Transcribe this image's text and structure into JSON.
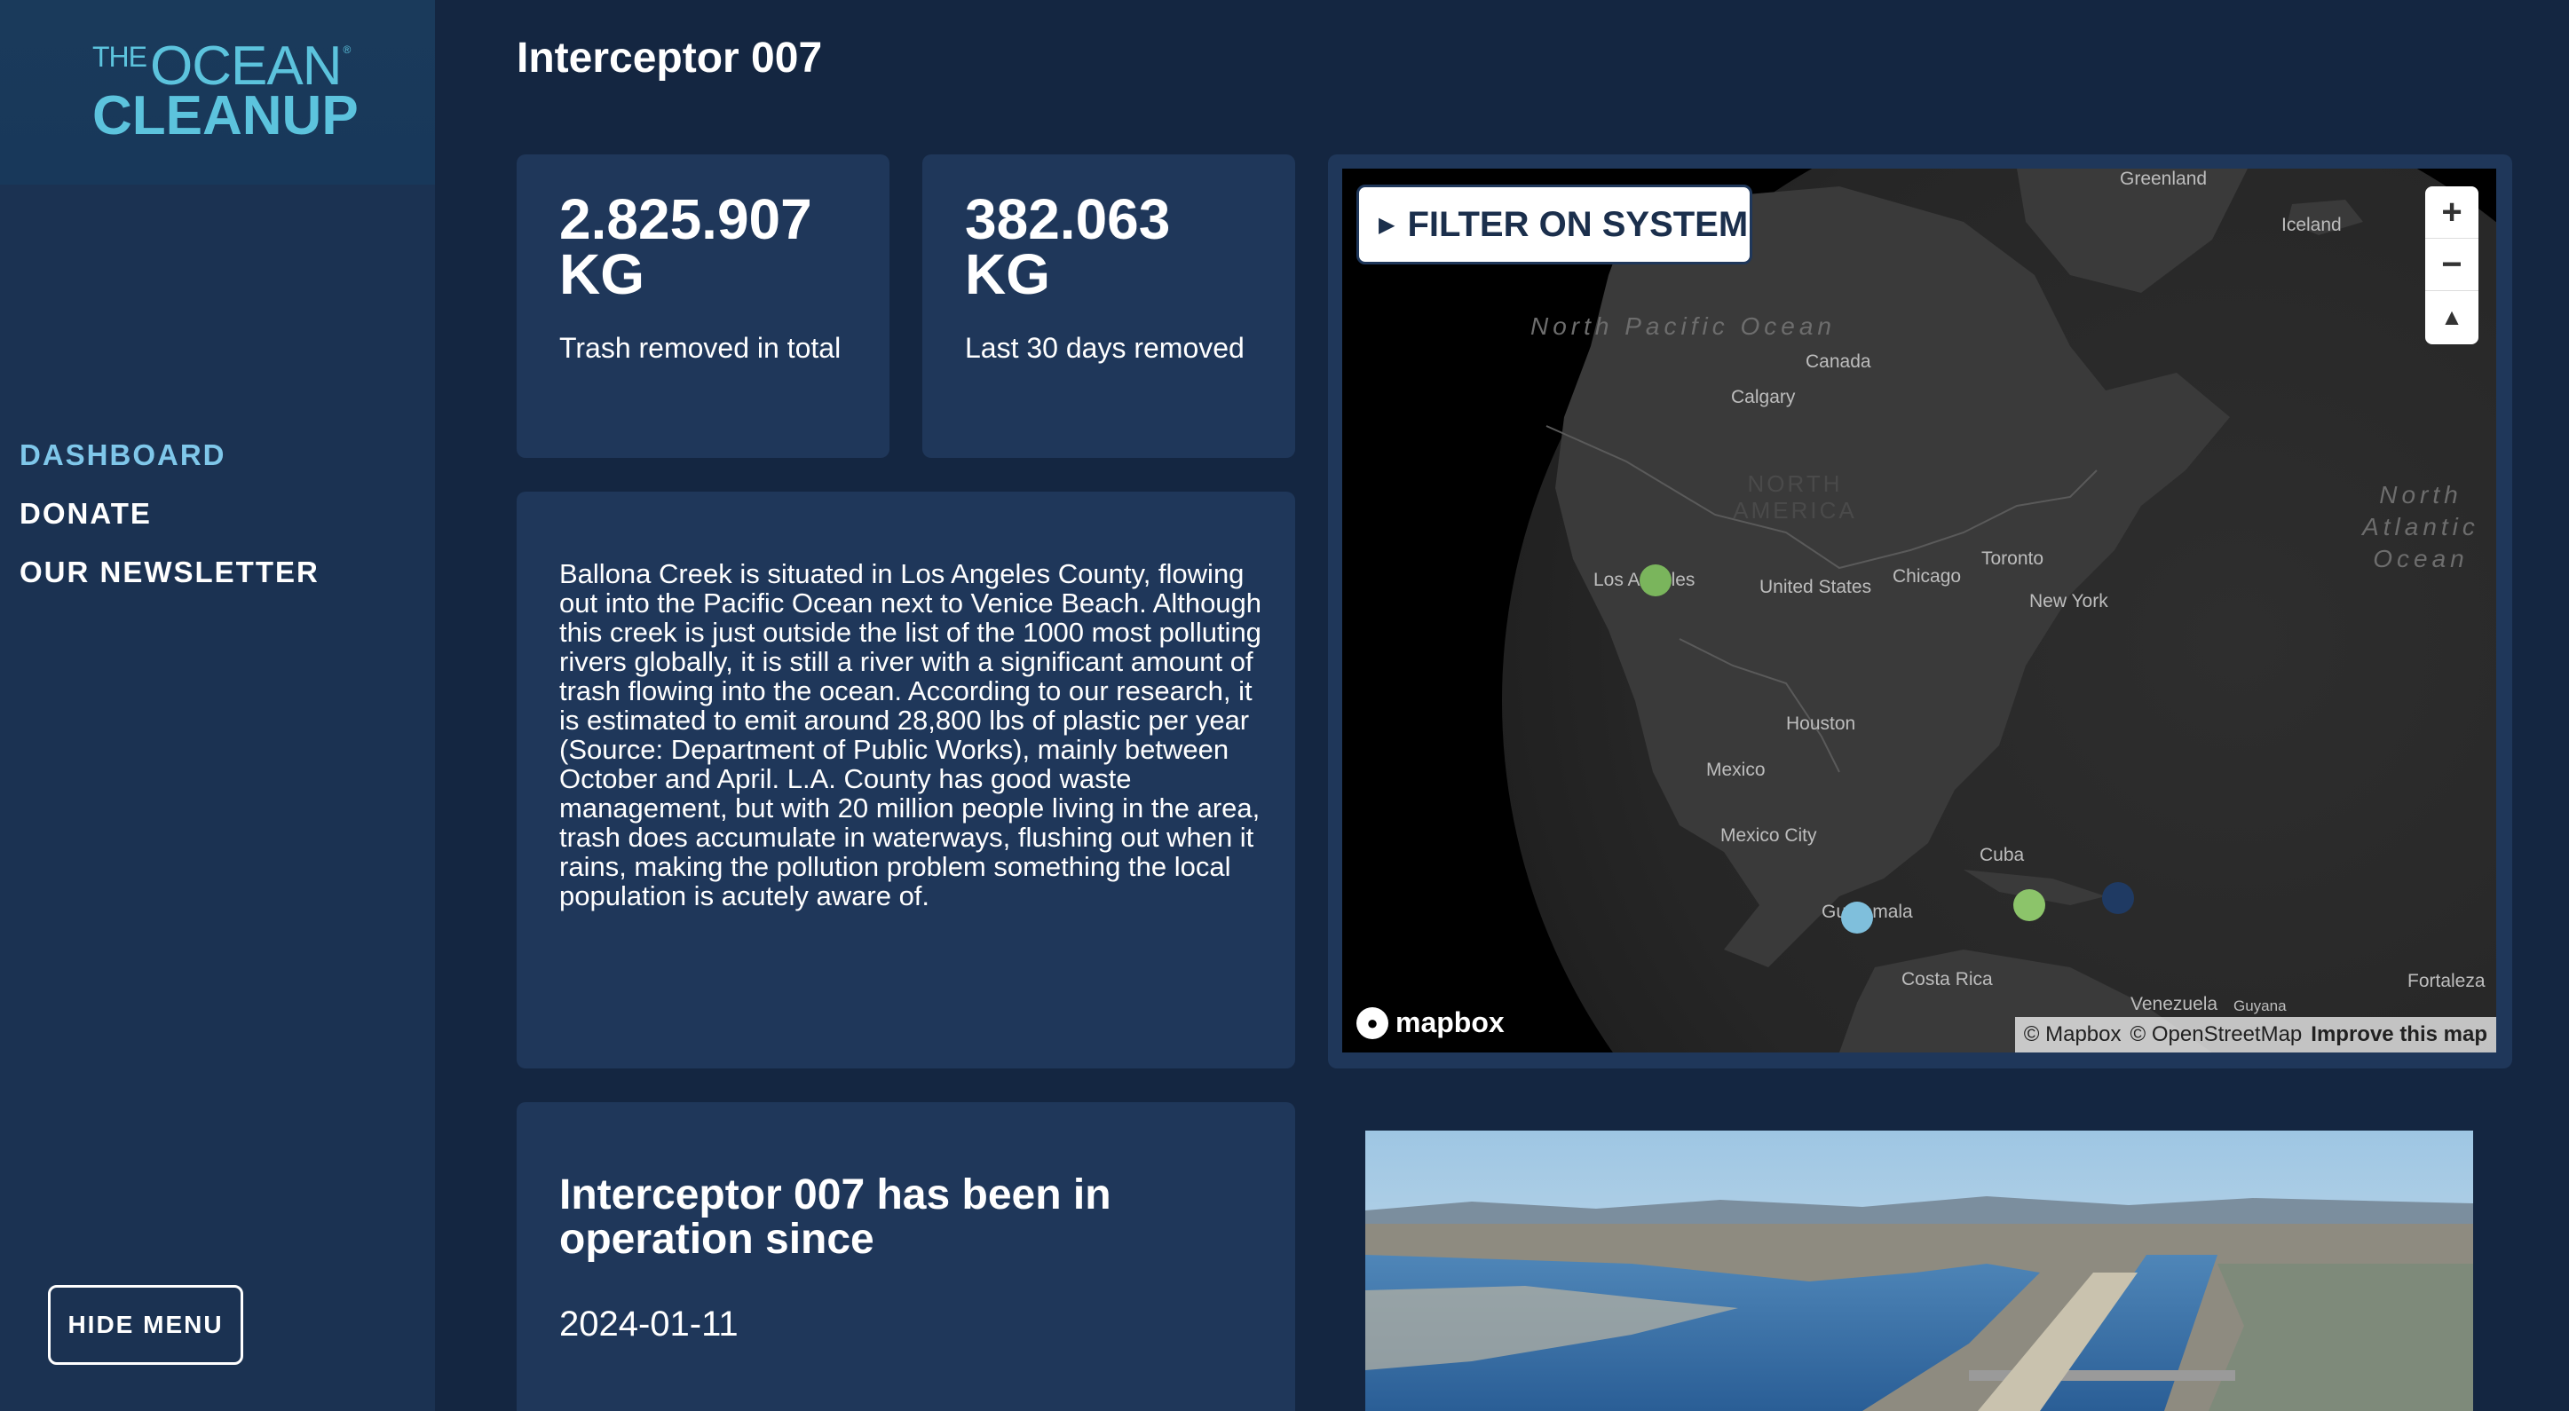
{
  "brand": {
    "logo_the": "THE",
    "logo_ocean": "OCEAN",
    "logo_reg": "®",
    "logo_cleanup": "CLEANUP"
  },
  "nav": {
    "items": [
      {
        "label": "DASHBOARD",
        "active": true
      },
      {
        "label": "DONATE",
        "active": false
      },
      {
        "label": "OUR NEWSLETTER",
        "active": false
      }
    ],
    "hide_menu_label": "HIDE MENU"
  },
  "page": {
    "title": "Interceptor 007"
  },
  "stats": [
    {
      "value_line1": "2.825.907",
      "value_line2": "KG",
      "label": "Trash removed in total"
    },
    {
      "value_line1": "382.063",
      "value_line2": "KG",
      "label": "Last 30 days removed"
    }
  ],
  "description": "Ballona Creek is situated in Los Angeles County, flowing out into the Pacific Ocean next to Venice Beach. Although this creek is just outside the list of the 1000 most polluting rivers globally, it is still a river with a significant amount of trash flowing into the ocean. According to our research, it is estimated to emit around 28,800 lbs of plastic per year (Source: Department of Public Works), mainly between October and April. L.A. County has good waste management, but with 20 million people living in the area, trash does accumulate in waterways, flushing out when it rains, making the pollution problem something the local population is acutely aware of.",
  "operation": {
    "title": "Interceptor 007 has been in operation since",
    "date": "2024-01-11"
  },
  "map": {
    "filter_label": "FILTER ON SYSTEM",
    "filter_arrow": "▶",
    "zoom_in": "+",
    "zoom_out": "−",
    "compass": "▲",
    "mapbox_label": "mapbox",
    "attribution_mapbox": "© Mapbox",
    "attribution_osm": "© OpenStreetMap",
    "attribution_improve": "Improve this map",
    "labels": {
      "greenland": "Greenland",
      "iceland": "Iceland",
      "canada": "Canada",
      "calgary": "Calgary",
      "north_america": "NORTH AMERICA",
      "los_angeles": "Los Angeles",
      "united_states": "United States",
      "chicago": "Chicago",
      "toronto": "Toronto",
      "new_york": "New York",
      "houston": "Houston",
      "mexico": "Mexico",
      "mexico_city": "Mexico City",
      "cuba": "Cuba",
      "guatemala": "Guatemala",
      "costa_rica": "Costa Rica",
      "venezuela": "Venezuela",
      "guyana": "Guyana",
      "fortaleza": "Fortaleza",
      "north_pacific": "North Pacific Ocean",
      "north_atlantic": "North Atlantic Ocean"
    },
    "markers": [
      {
        "name": "los-angeles",
        "color": "#7ab55c"
      },
      {
        "name": "guatemala",
        "color": "#7fbfdc"
      },
      {
        "name": "caribbean-1",
        "color": "#8cc46a"
      },
      {
        "name": "caribbean-2",
        "color": "#1f3a63"
      }
    ]
  },
  "colors": {
    "background": "#142641",
    "sidebar": "#1b3252",
    "card": "#1f375a",
    "accent": "#7fc7ea",
    "logo": "#5cc3dd"
  }
}
